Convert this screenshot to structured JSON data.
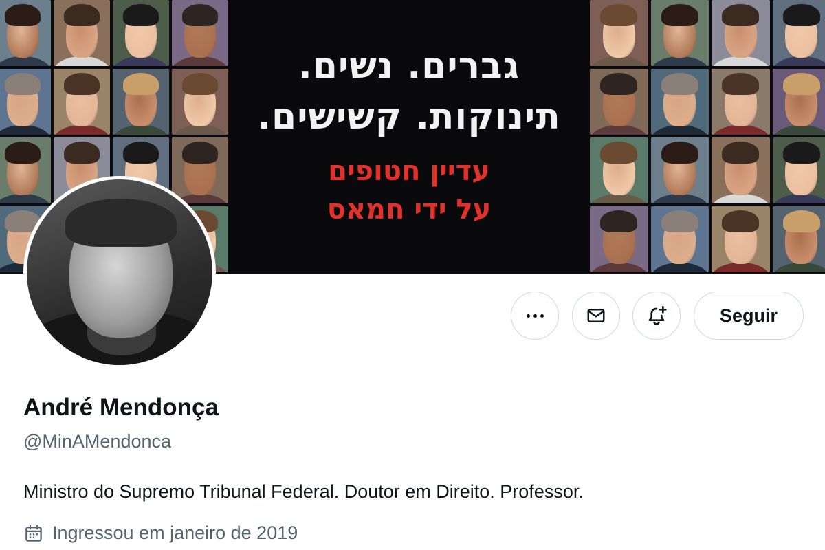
{
  "banner": {
    "headline_line1": "גברים. נשים.",
    "headline_line2": "תינוקות. קשישים.",
    "subline_line1": "עדיין חטופים",
    "subline_line2": "על ידי חמאס",
    "headline_color": "#f2f2f2",
    "subline_color": "#e2302a",
    "background_color": "#0a0a0d"
  },
  "profile": {
    "name": "André Mendonça",
    "handle": "@MinAMendonca",
    "bio": "Ministro do Supremo Tribunal Federal. Doutor em Direito. Professor.",
    "joined": "Ingressou em janeiro de 2019",
    "joined_icon": "calendar-icon"
  },
  "actions": {
    "more_icon": "more-icon",
    "message_icon": "mail-icon",
    "notify_icon": "bell-plus-icon",
    "follow_label": "Seguir"
  },
  "colors": {
    "text_primary": "#0f1419",
    "text_secondary": "#536471",
    "border": "#cfd9de"
  }
}
